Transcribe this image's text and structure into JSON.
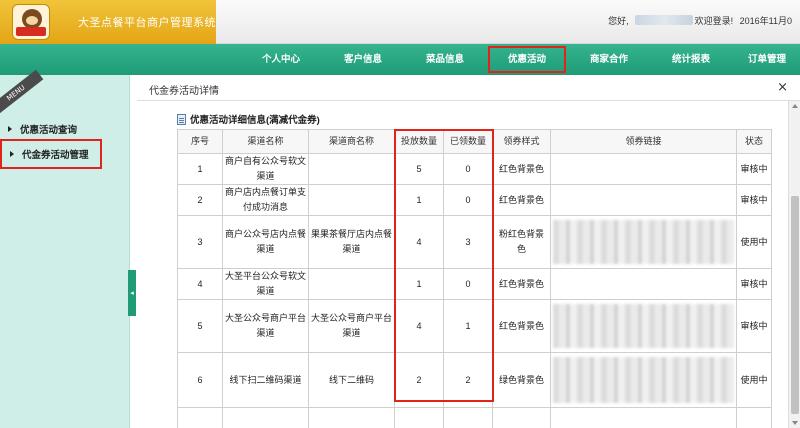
{
  "header": {
    "system_title": "大圣点餐平台商户管理系统",
    "greeting_prefix": "您好,",
    "greeting_suffix": "欢迎登录!",
    "date": "2016年11月0"
  },
  "nav": {
    "items": [
      {
        "label": "个人中心"
      },
      {
        "label": "客户信息"
      },
      {
        "label": "菜品信息"
      },
      {
        "label": "优惠活动",
        "active": true
      },
      {
        "label": "商家合作"
      },
      {
        "label": "统计报表"
      },
      {
        "label": "订单管理"
      }
    ]
  },
  "sidebar": {
    "ribbon": "MENU",
    "items": [
      {
        "label": "优惠活动查询"
      },
      {
        "label": "代金券活动管理",
        "active": true
      }
    ]
  },
  "dialog": {
    "title": "代金券活动详情",
    "close_symbol": "×",
    "section_title": "优惠活动详细信息(满减代金券)"
  },
  "table": {
    "headers": [
      "序号",
      "渠道名称",
      "渠道商名称",
      "投放数量",
      "已领数量",
      "领券样式",
      "领券链接",
      "状态"
    ],
    "rows": [
      {
        "no": "1",
        "channel": "商户自有公众号软文渠道",
        "vendor": "",
        "issued": "5",
        "claimed": "0",
        "style": "红色背景色",
        "link_blurred": false,
        "status": "审核中"
      },
      {
        "no": "2",
        "channel": "商户店内点餐订单支付成功消息",
        "vendor": "",
        "issued": "1",
        "claimed": "0",
        "style": "红色背景色",
        "link_blurred": false,
        "status": "审核中"
      },
      {
        "no": "3",
        "channel": "商户公众号店内点餐渠道",
        "vendor": "果果茶餐厅店内点餐渠道",
        "issued": "4",
        "claimed": "3",
        "style": "粉红色背景色",
        "link_blurred": true,
        "status": "使用中"
      },
      {
        "no": "4",
        "channel": "大圣平台公众号软文渠道",
        "vendor": "",
        "issued": "1",
        "claimed": "0",
        "style": "红色背景色",
        "link_blurred": false,
        "status": "审核中"
      },
      {
        "no": "5",
        "channel": "大圣公众号商户平台渠道",
        "vendor": "大圣公众号商户平台渠道",
        "issued": "4",
        "claimed": "1",
        "style": "红色背景色",
        "link_blurred": true,
        "status": "审核中"
      },
      {
        "no": "6",
        "channel": "线下扫二维码渠道",
        "vendor": "线下二维码",
        "issued": "2",
        "claimed": "2",
        "style": "绿色背景色",
        "link_blurred": true,
        "status": "使用中"
      }
    ]
  },
  "colors": {
    "nav_bg": "#1f9b78",
    "brand_bg": "#e4a516",
    "sidebar_bg": "#cfeee7",
    "highlight_red": "#e0231b"
  }
}
